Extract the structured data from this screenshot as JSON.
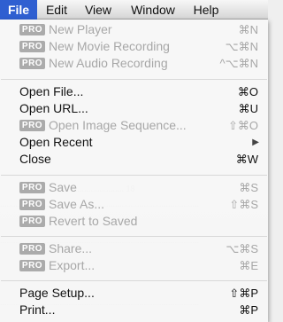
{
  "menubar": {
    "items": [
      "File",
      "Edit",
      "View",
      "Window",
      "Help"
    ],
    "active": "File"
  },
  "menu": {
    "pro_badge": "PRO",
    "items": [
      {
        "label": "New Player",
        "shortcut": "⌘N",
        "pro": true,
        "enabled": false
      },
      {
        "label": "New Movie Recording",
        "shortcut": "⌥⌘N",
        "pro": true,
        "enabled": false
      },
      {
        "label": "New Audio Recording",
        "shortcut": "^⌥⌘N",
        "pro": true,
        "enabled": false
      },
      {
        "label": "Open File...",
        "shortcut": "⌘O",
        "pro": false,
        "enabled": true
      },
      {
        "label": "Open URL...",
        "shortcut": "⌘U",
        "pro": false,
        "enabled": true
      },
      {
        "label": "Open Image Sequence...",
        "shortcut": "⇧⌘O",
        "pro": true,
        "enabled": false
      },
      {
        "label": "Open Recent",
        "shortcut": "",
        "pro": false,
        "enabled": true,
        "submenu": true
      },
      {
        "label": "Close",
        "shortcut": "⌘W",
        "pro": false,
        "enabled": true
      },
      {
        "label": "Save",
        "shortcut": "⌘S",
        "pro": true,
        "enabled": false
      },
      {
        "label": "Save As...",
        "shortcut": "⇧⌘S",
        "pro": true,
        "enabled": false
      },
      {
        "label": "Revert to Saved",
        "shortcut": "",
        "pro": true,
        "enabled": false
      },
      {
        "label": "Share...",
        "shortcut": "⌥⌘S",
        "pro": true,
        "enabled": false
      },
      {
        "label": "Export...",
        "shortcut": "⌘E",
        "pro": true,
        "enabled": false
      },
      {
        "label": "Page Setup...",
        "shortcut": "⇧⌘P",
        "pro": false,
        "enabled": true
      },
      {
        "label": "Print...",
        "shortcut": "⌘P",
        "pro": false,
        "enabled": true
      }
    ],
    "submenu_arrow_icon": "triangle-right-icon"
  }
}
